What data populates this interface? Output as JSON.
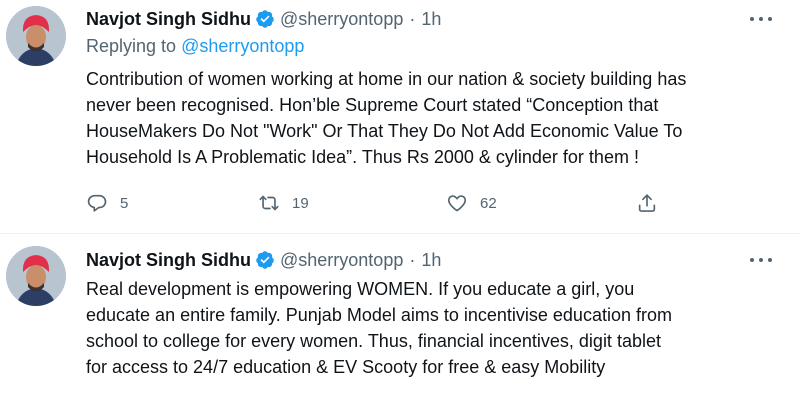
{
  "tweets": [
    {
      "author_name": "Navjot Singh Sidhu",
      "handle": "@sherryontopp",
      "separator": "·",
      "time": "1h",
      "replying_to_prefix": "Replying to",
      "replying_to_handle": "@sherryontopp",
      "text_lines": [
        "Contribution of women working at home in our nation & society building has",
        "never been recognised. Hon’ble Supreme Court stated “Conception that",
        "HouseMakers Do Not \"Work\" Or That They Do Not Add Economic Value To",
        "Household Is A Problematic Idea”. Thus Rs 2000 & cylinder for them !"
      ],
      "replies": "5",
      "retweets": "19",
      "likes": "62"
    },
    {
      "author_name": "Navjot Singh Sidhu",
      "handle": "@sherryontopp",
      "separator": "·",
      "time": "1h",
      "text_lines": [
        "Real development is empowering WOMEN. If you educate a girl, you",
        "educate an entire family. Punjab Model aims to incentivise education from",
        "school to college for every women. Thus, financial incentives, digit tablet",
        "for access to 24/7 education & EV Scooty for free & easy Mobility"
      ]
    }
  ],
  "icons": {
    "verified": "verified-badge-icon",
    "more": "more-options-icon",
    "reply": "reply-icon",
    "retweet": "retweet-icon",
    "like": "like-icon",
    "share": "share-icon"
  },
  "colors": {
    "primary_text": "#0f1419",
    "secondary_text": "#536471",
    "accent": "#1d9bf0",
    "divider": "#eff3f4"
  }
}
